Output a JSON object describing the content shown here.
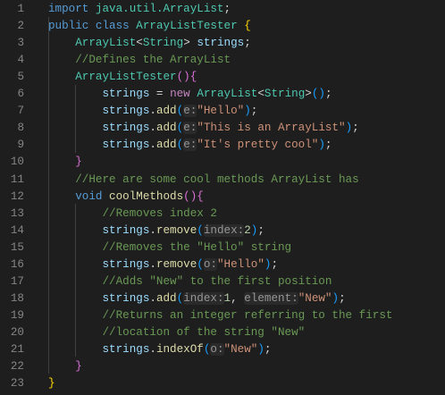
{
  "editor": {
    "language": "java",
    "theme_colors": {
      "background": "#1e1e1e",
      "keyword": "#569cd6",
      "type": "#4ec9b0",
      "variable": "#9cdcfe",
      "method": "#dcdcaa",
      "string": "#ce9178",
      "comment": "#6a9955",
      "number": "#b5cea8"
    },
    "lines": [
      {
        "number": "1",
        "indent": 0,
        "tokens": [
          [
            "keyword",
            "import"
          ],
          [
            "plain",
            " "
          ],
          [
            "type",
            "java.util.ArrayList"
          ],
          [
            "plain",
            ";"
          ]
        ]
      },
      {
        "number": "2",
        "indent": 0,
        "tokens": [
          [
            "keyword",
            "public"
          ],
          [
            "plain",
            " "
          ],
          [
            "keyword",
            "class"
          ],
          [
            "plain",
            " "
          ],
          [
            "type",
            "ArrayListTester"
          ],
          [
            "plain",
            " "
          ],
          [
            "b1",
            "{"
          ]
        ]
      },
      {
        "number": "3",
        "indent": 1,
        "tokens": [
          [
            "type",
            "ArrayList"
          ],
          [
            "plain",
            "<"
          ],
          [
            "type",
            "String"
          ],
          [
            "plain",
            "> "
          ],
          [
            "var",
            "strings"
          ],
          [
            "plain",
            ";"
          ]
        ]
      },
      {
        "number": "4",
        "indent": 1,
        "tokens": [
          [
            "comment",
            "//Defines the ArrayList"
          ]
        ]
      },
      {
        "number": "5",
        "indent": 1,
        "tokens": [
          [
            "type",
            "ArrayListTester"
          ],
          [
            "b2",
            "()"
          ],
          [
            "b2",
            "{"
          ]
        ]
      },
      {
        "number": "6",
        "indent": 2,
        "tokens": [
          [
            "var",
            "strings"
          ],
          [
            "plain",
            " = "
          ],
          [
            "control",
            "new"
          ],
          [
            "plain",
            " "
          ],
          [
            "type",
            "ArrayList"
          ],
          [
            "plain",
            "<"
          ],
          [
            "type",
            "String"
          ],
          [
            "plain",
            ">"
          ],
          [
            "b3",
            "()"
          ],
          [
            "plain",
            ";"
          ]
        ]
      },
      {
        "number": "7",
        "indent": 2,
        "tokens": [
          [
            "var",
            "strings"
          ],
          [
            "plain",
            "."
          ],
          [
            "method",
            "add"
          ],
          [
            "b3",
            "("
          ],
          [
            "hint",
            "e:"
          ],
          [
            "string",
            "\"Hello\""
          ],
          [
            "b3",
            ")"
          ],
          [
            "plain",
            ";"
          ]
        ]
      },
      {
        "number": "8",
        "indent": 2,
        "tokens": [
          [
            "var",
            "strings"
          ],
          [
            "plain",
            "."
          ],
          [
            "method",
            "add"
          ],
          [
            "b3",
            "("
          ],
          [
            "hint",
            "e:"
          ],
          [
            "string",
            "\"This is an ArrayList\""
          ],
          [
            "b3",
            ")"
          ],
          [
            "plain",
            ";"
          ]
        ]
      },
      {
        "number": "9",
        "indent": 2,
        "tokens": [
          [
            "var",
            "strings"
          ],
          [
            "plain",
            "."
          ],
          [
            "method",
            "add"
          ],
          [
            "b3",
            "("
          ],
          [
            "hint",
            "e:"
          ],
          [
            "string",
            "\"It's pretty cool\""
          ],
          [
            "b3",
            ")"
          ],
          [
            "plain",
            ";"
          ]
        ]
      },
      {
        "number": "10",
        "indent": 1,
        "tokens": [
          [
            "b2",
            "}"
          ]
        ]
      },
      {
        "number": "11",
        "indent": 1,
        "tokens": [
          [
            "comment",
            "//Here are some cool methods ArrayList has"
          ]
        ]
      },
      {
        "number": "12",
        "indent": 1,
        "tokens": [
          [
            "keyword",
            "void"
          ],
          [
            "plain",
            " "
          ],
          [
            "method",
            "coolMethods"
          ],
          [
            "b2",
            "()"
          ],
          [
            "b2",
            "{"
          ]
        ]
      },
      {
        "number": "13",
        "indent": 2,
        "tokens": [
          [
            "comment",
            "//Removes index 2"
          ]
        ]
      },
      {
        "number": "14",
        "indent": 2,
        "tokens": [
          [
            "var",
            "strings"
          ],
          [
            "plain",
            "."
          ],
          [
            "method",
            "remove"
          ],
          [
            "b3",
            "("
          ],
          [
            "hint",
            "index:"
          ],
          [
            "number",
            "2"
          ],
          [
            "b3",
            ")"
          ],
          [
            "plain",
            ";"
          ]
        ]
      },
      {
        "number": "15",
        "indent": 2,
        "tokens": [
          [
            "comment",
            "//Removes the \"Hello\" string"
          ]
        ]
      },
      {
        "number": "16",
        "indent": 2,
        "tokens": [
          [
            "var",
            "strings"
          ],
          [
            "plain",
            "."
          ],
          [
            "method",
            "remove"
          ],
          [
            "b3",
            "("
          ],
          [
            "hint",
            "o:"
          ],
          [
            "string",
            "\"Hello\""
          ],
          [
            "b3",
            ")"
          ],
          [
            "plain",
            ";"
          ]
        ]
      },
      {
        "number": "17",
        "indent": 2,
        "tokens": [
          [
            "comment",
            "//Adds \"New\" to the first position"
          ]
        ]
      },
      {
        "number": "18",
        "indent": 2,
        "tokens": [
          [
            "var",
            "strings"
          ],
          [
            "plain",
            "."
          ],
          [
            "method",
            "add"
          ],
          [
            "b3",
            "("
          ],
          [
            "hint",
            "index:"
          ],
          [
            "number",
            "1"
          ],
          [
            "plain",
            ", "
          ],
          [
            "hint",
            "element:"
          ],
          [
            "string",
            "\"New\""
          ],
          [
            "b3",
            ")"
          ],
          [
            "plain",
            ";"
          ]
        ]
      },
      {
        "number": "19",
        "indent": 2,
        "tokens": [
          [
            "comment",
            "//Returns an integer referring to the first"
          ]
        ]
      },
      {
        "number": "20",
        "indent": 2,
        "tokens": [
          [
            "comment",
            "//location of the string \"New\""
          ]
        ]
      },
      {
        "number": "21",
        "indent": 2,
        "tokens": [
          [
            "var",
            "strings"
          ],
          [
            "plain",
            "."
          ],
          [
            "method",
            "indexOf"
          ],
          [
            "b3",
            "("
          ],
          [
            "hint",
            "o:"
          ],
          [
            "string",
            "\"New\""
          ],
          [
            "b3",
            ")"
          ],
          [
            "plain",
            ";"
          ]
        ]
      },
      {
        "number": "22",
        "indent": 1,
        "tokens": [
          [
            "b2",
            "}"
          ]
        ]
      },
      {
        "number": "23",
        "indent": 0,
        "tokens": [
          [
            "b1",
            "}"
          ]
        ]
      }
    ]
  }
}
